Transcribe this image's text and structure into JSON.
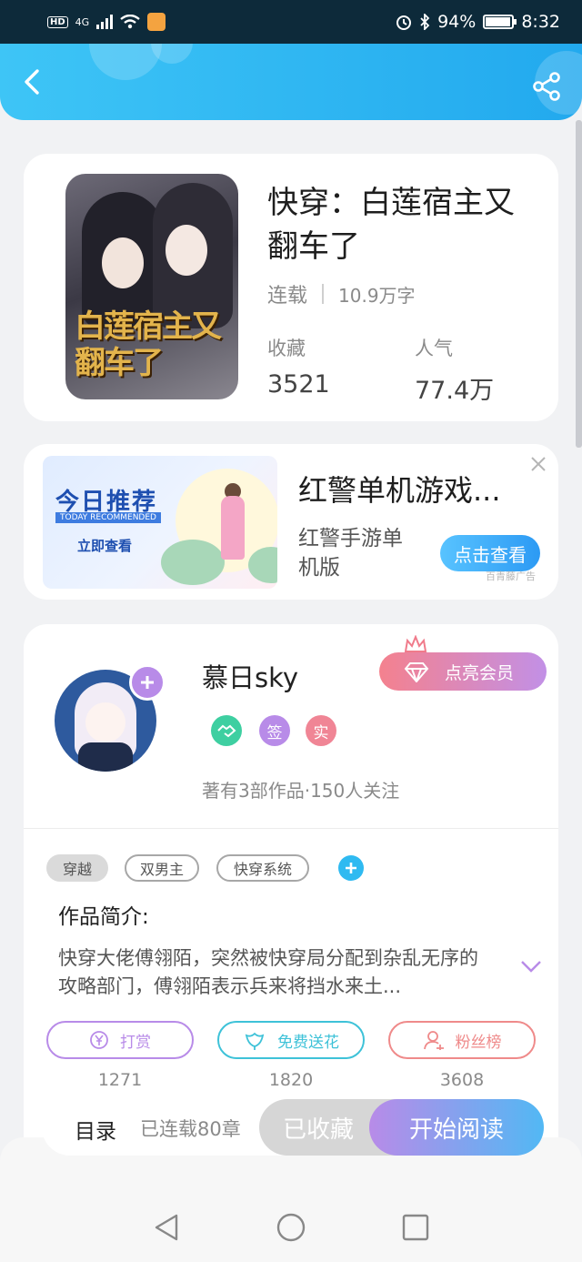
{
  "status_bar": {
    "hd": "HD",
    "signal": "4G",
    "battery_percent": "94%",
    "battery_level": 0.94,
    "time": "8:32"
  },
  "header": {
    "back_icon": "chevron-left-icon",
    "share_icon": "share-icon"
  },
  "book": {
    "cover_text": "白莲宿主又翻车了",
    "title": "快穿：白莲宿主又翻车了",
    "status": "连载",
    "word_count": "10.9万字",
    "favorites_label": "收藏",
    "favorites_value": "3521",
    "popularity_label": "人气",
    "popularity_value": "77.4万"
  },
  "ad": {
    "banner_title": "今日推荐",
    "banner_subtitle": "TODAY RECOMMENDED",
    "banner_cta": "立即查看",
    "title": "红警单机游戏...",
    "subtitle": "红警手游单机版",
    "button": "点击查看",
    "source": "百青藤广告",
    "close_icon": "close-icon"
  },
  "author": {
    "name": "慕日sky",
    "vip_button": "点亮会员",
    "badges": [
      {
        "label": "",
        "icon": "handshake-icon",
        "color": "#3ecfa1"
      },
      {
        "label": "签",
        "color": "#b88be8"
      },
      {
        "label": "实",
        "color": "#f08595"
      }
    ],
    "stats": "著有3部作品·150人关注"
  },
  "tags": [
    "穿越",
    "双男主",
    "快穿系统"
  ],
  "intro": {
    "title": "作品简介:",
    "body": "快穿大佬傅翎陌，突然被快穿局分配到杂乱无序的攻略部门，傅翎陌表示兵来将挡水来土..."
  },
  "actions": [
    {
      "label": "打赏",
      "icon": "yen-icon",
      "count": "1271",
      "color": "#b88be8"
    },
    {
      "label": "免费送花",
      "icon": "flower-icon",
      "count": "1820",
      "color": "#3ec2d8"
    },
    {
      "label": "粉丝榜",
      "icon": "user-icon",
      "count": "3608",
      "color": "#ef8a8a"
    }
  ],
  "bottom_bar": {
    "toc": "目录",
    "chapter_count": "已连载80章",
    "collected": "已收藏",
    "start_reading": "开始阅读"
  },
  "nav": {
    "back": "triangle-back-icon",
    "home": "circle-home-icon",
    "recents": "square-recents-icon"
  }
}
